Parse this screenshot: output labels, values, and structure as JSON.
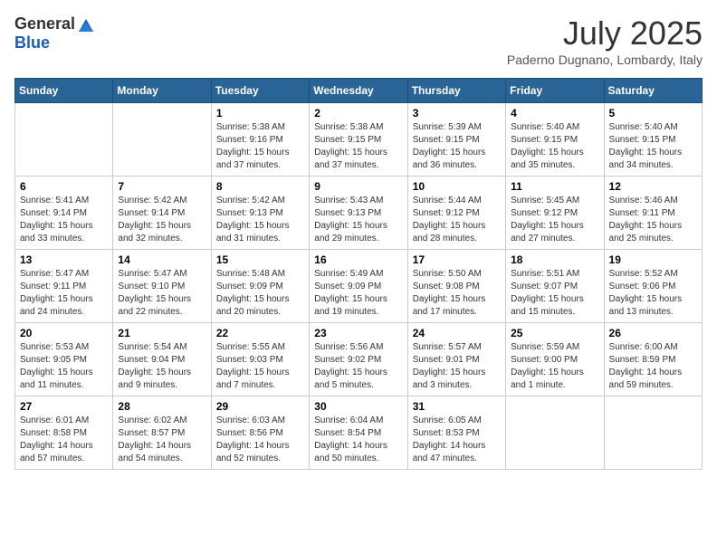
{
  "header": {
    "logo_general": "General",
    "logo_blue": "Blue",
    "title": "July 2025",
    "location": "Paderno Dugnano, Lombardy, Italy"
  },
  "calendar": {
    "days_of_week": [
      "Sunday",
      "Monday",
      "Tuesday",
      "Wednesday",
      "Thursday",
      "Friday",
      "Saturday"
    ],
    "weeks": [
      [
        {
          "day": "",
          "info": ""
        },
        {
          "day": "",
          "info": ""
        },
        {
          "day": "1",
          "info": "Sunrise: 5:38 AM\nSunset: 9:16 PM\nDaylight: 15 hours and 37 minutes."
        },
        {
          "day": "2",
          "info": "Sunrise: 5:38 AM\nSunset: 9:15 PM\nDaylight: 15 hours and 37 minutes."
        },
        {
          "day": "3",
          "info": "Sunrise: 5:39 AM\nSunset: 9:15 PM\nDaylight: 15 hours and 36 minutes."
        },
        {
          "day": "4",
          "info": "Sunrise: 5:40 AM\nSunset: 9:15 PM\nDaylight: 15 hours and 35 minutes."
        },
        {
          "day": "5",
          "info": "Sunrise: 5:40 AM\nSunset: 9:15 PM\nDaylight: 15 hours and 34 minutes."
        }
      ],
      [
        {
          "day": "6",
          "info": "Sunrise: 5:41 AM\nSunset: 9:14 PM\nDaylight: 15 hours and 33 minutes."
        },
        {
          "day": "7",
          "info": "Sunrise: 5:42 AM\nSunset: 9:14 PM\nDaylight: 15 hours and 32 minutes."
        },
        {
          "day": "8",
          "info": "Sunrise: 5:42 AM\nSunset: 9:13 PM\nDaylight: 15 hours and 31 minutes."
        },
        {
          "day": "9",
          "info": "Sunrise: 5:43 AM\nSunset: 9:13 PM\nDaylight: 15 hours and 29 minutes."
        },
        {
          "day": "10",
          "info": "Sunrise: 5:44 AM\nSunset: 9:12 PM\nDaylight: 15 hours and 28 minutes."
        },
        {
          "day": "11",
          "info": "Sunrise: 5:45 AM\nSunset: 9:12 PM\nDaylight: 15 hours and 27 minutes."
        },
        {
          "day": "12",
          "info": "Sunrise: 5:46 AM\nSunset: 9:11 PM\nDaylight: 15 hours and 25 minutes."
        }
      ],
      [
        {
          "day": "13",
          "info": "Sunrise: 5:47 AM\nSunset: 9:11 PM\nDaylight: 15 hours and 24 minutes."
        },
        {
          "day": "14",
          "info": "Sunrise: 5:47 AM\nSunset: 9:10 PM\nDaylight: 15 hours and 22 minutes."
        },
        {
          "day": "15",
          "info": "Sunrise: 5:48 AM\nSunset: 9:09 PM\nDaylight: 15 hours and 20 minutes."
        },
        {
          "day": "16",
          "info": "Sunrise: 5:49 AM\nSunset: 9:09 PM\nDaylight: 15 hours and 19 minutes."
        },
        {
          "day": "17",
          "info": "Sunrise: 5:50 AM\nSunset: 9:08 PM\nDaylight: 15 hours and 17 minutes."
        },
        {
          "day": "18",
          "info": "Sunrise: 5:51 AM\nSunset: 9:07 PM\nDaylight: 15 hours and 15 minutes."
        },
        {
          "day": "19",
          "info": "Sunrise: 5:52 AM\nSunset: 9:06 PM\nDaylight: 15 hours and 13 minutes."
        }
      ],
      [
        {
          "day": "20",
          "info": "Sunrise: 5:53 AM\nSunset: 9:05 PM\nDaylight: 15 hours and 11 minutes."
        },
        {
          "day": "21",
          "info": "Sunrise: 5:54 AM\nSunset: 9:04 PM\nDaylight: 15 hours and 9 minutes."
        },
        {
          "day": "22",
          "info": "Sunrise: 5:55 AM\nSunset: 9:03 PM\nDaylight: 15 hours and 7 minutes."
        },
        {
          "day": "23",
          "info": "Sunrise: 5:56 AM\nSunset: 9:02 PM\nDaylight: 15 hours and 5 minutes."
        },
        {
          "day": "24",
          "info": "Sunrise: 5:57 AM\nSunset: 9:01 PM\nDaylight: 15 hours and 3 minutes."
        },
        {
          "day": "25",
          "info": "Sunrise: 5:59 AM\nSunset: 9:00 PM\nDaylight: 15 hours and 1 minute."
        },
        {
          "day": "26",
          "info": "Sunrise: 6:00 AM\nSunset: 8:59 PM\nDaylight: 14 hours and 59 minutes."
        }
      ],
      [
        {
          "day": "27",
          "info": "Sunrise: 6:01 AM\nSunset: 8:58 PM\nDaylight: 14 hours and 57 minutes."
        },
        {
          "day": "28",
          "info": "Sunrise: 6:02 AM\nSunset: 8:57 PM\nDaylight: 14 hours and 54 minutes."
        },
        {
          "day": "29",
          "info": "Sunrise: 6:03 AM\nSunset: 8:56 PM\nDaylight: 14 hours and 52 minutes."
        },
        {
          "day": "30",
          "info": "Sunrise: 6:04 AM\nSunset: 8:54 PM\nDaylight: 14 hours and 50 minutes."
        },
        {
          "day": "31",
          "info": "Sunrise: 6:05 AM\nSunset: 8:53 PM\nDaylight: 14 hours and 47 minutes."
        },
        {
          "day": "",
          "info": ""
        },
        {
          "day": "",
          "info": ""
        }
      ]
    ]
  }
}
